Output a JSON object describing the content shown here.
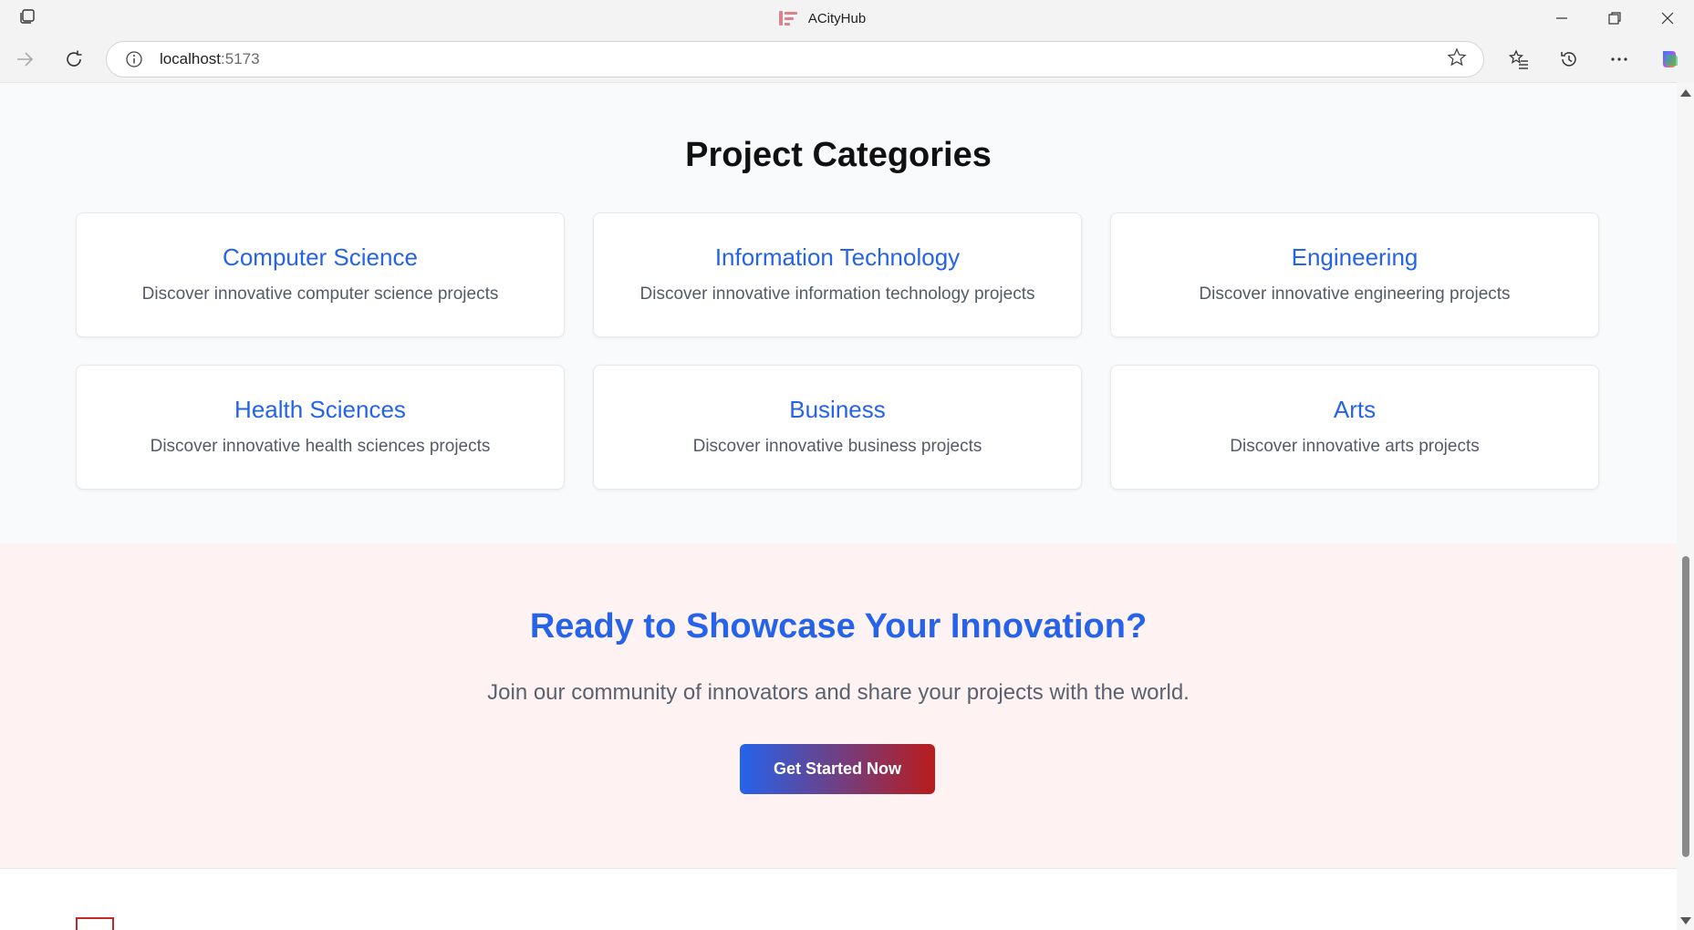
{
  "browser": {
    "window_title": "ACityHub",
    "url_host": "localhost",
    "url_port": ":5173"
  },
  "categories": {
    "title": "Project Categories",
    "items": [
      {
        "title": "Computer Science",
        "description": "Discover innovative computer science projects"
      },
      {
        "title": "Information Technology",
        "description": "Discover innovative information technology projects"
      },
      {
        "title": "Engineering",
        "description": "Discover innovative engineering projects"
      },
      {
        "title": "Health Sciences",
        "description": "Discover innovative health sciences projects"
      },
      {
        "title": "Business",
        "description": "Discover innovative business projects"
      },
      {
        "title": "Arts",
        "description": "Discover innovative arts projects"
      }
    ]
  },
  "cta": {
    "title": "Ready to Showcase Your Innovation?",
    "subtitle": "Join our community of innovators and share your projects with the world.",
    "button_label": "Get Started Now"
  },
  "colors": {
    "accent_blue": "#2563eb",
    "accent_red": "#b91c1c",
    "cta_background": "#fef2f2",
    "section_background": "#f9fafb"
  }
}
